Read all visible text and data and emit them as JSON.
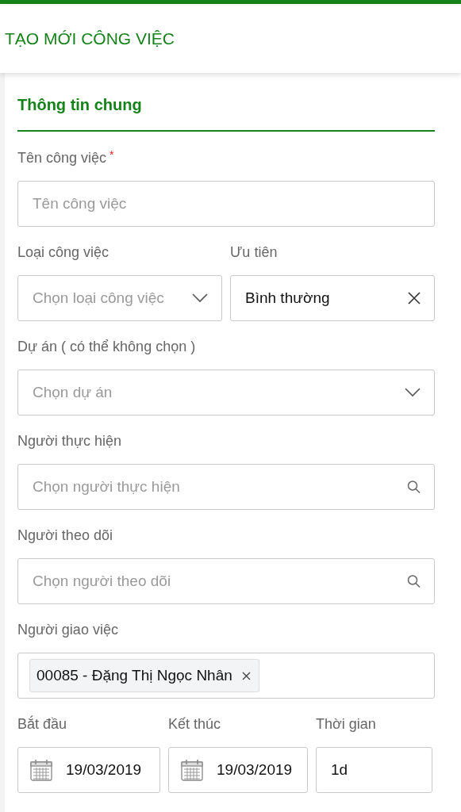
{
  "header": {
    "title": "TẠO MỚI CÔNG VIỆC"
  },
  "section": {
    "title": "Thông tin chung"
  },
  "rows": [
    {
      "fields": [
        {
          "label": "Tên công việc",
          "required_mark": "*",
          "kind": "text",
          "placeholder": "Tên công việc"
        }
      ]
    },
    {
      "fields": [
        {
          "label": "Loại công việc",
          "kind": "select",
          "placeholder": "Chọn loại công việc"
        },
        {
          "label": "Ưu tiên",
          "kind": "clearable",
          "value": "Bình thường"
        }
      ]
    },
    {
      "fields": [
        {
          "label": "Dự án ( có thể không chọn )",
          "kind": "select",
          "placeholder": "Chọn dự án"
        }
      ]
    },
    {
      "fields": [
        {
          "label": "Người thực hiện",
          "kind": "search",
          "placeholder": "Chọn người thực hiện"
        }
      ]
    },
    {
      "fields": [
        {
          "label": "Người theo dõi",
          "kind": "search",
          "placeholder": "Chọn người theo dõi"
        }
      ]
    },
    {
      "fields": [
        {
          "label": "Người giao việc",
          "kind": "tags",
          "tags": [
            "00085 - Đặng Thị Ngọc Nhân"
          ]
        }
      ]
    },
    {
      "fields": [
        {
          "label": "Bắt đầu",
          "kind": "date",
          "value": "19/03/2019"
        },
        {
          "label": "Kết thúc",
          "kind": "date",
          "value": "19/03/2019"
        },
        {
          "label": "Thời gian",
          "kind": "text",
          "value": "1d"
        }
      ]
    }
  ]
}
